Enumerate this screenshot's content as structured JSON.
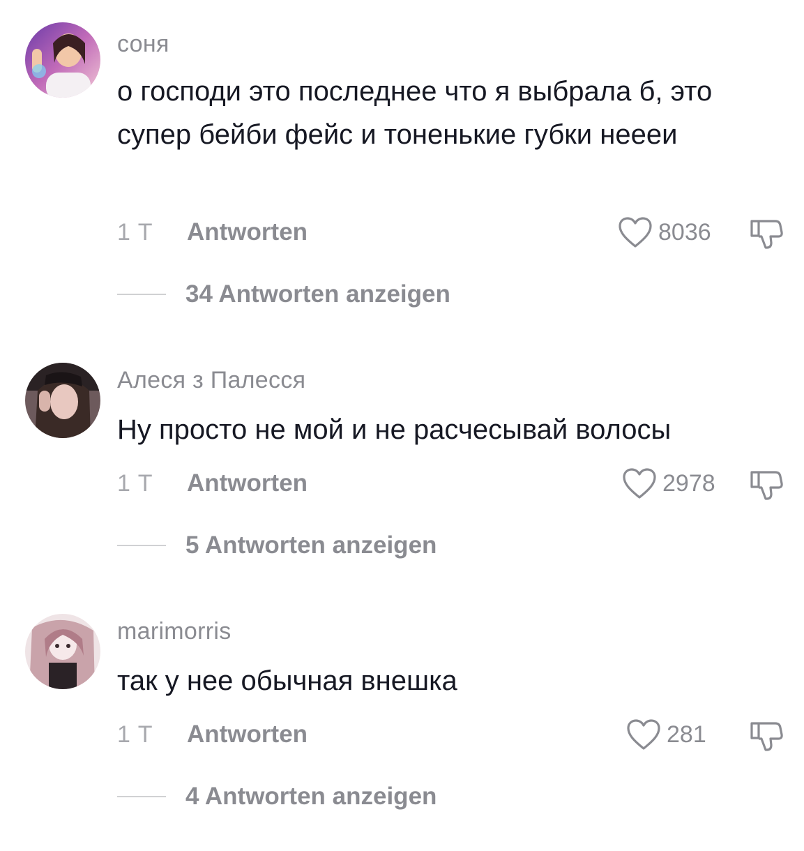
{
  "comments": [
    {
      "username": "соня",
      "text": "о господи это последнее что я выбрала б, это супер бейби фейс и тоненькие губки нееeи",
      "time": "1 T",
      "reply_label": "Antworten",
      "likes": "8036",
      "view_replies": "34 Antworten anzeigen"
    },
    {
      "username": "Алеся з Палесся",
      "text": "Ну просто не мой и не расчесывай волосы",
      "time": "1 T",
      "reply_label": "Antworten",
      "likes": "2978",
      "view_replies": "5 Antworten anzeigen"
    },
    {
      "username": "marimorris",
      "text": "так у нее обычная внешка",
      "time": "1 T",
      "reply_label": "Antworten",
      "likes": "281",
      "view_replies": "4 Antworten anzeigen"
    }
  ],
  "icons": {
    "like": "heart-outline-icon",
    "dislike": "thumbs-down-outline-icon"
  },
  "colors": {
    "secondary_text": "#8a8b91",
    "primary_text": "#161823"
  }
}
